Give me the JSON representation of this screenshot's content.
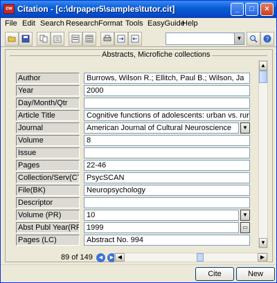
{
  "window": {
    "title": "Citation - [c:\\drpaper5\\samples\\tutor.cit]",
    "app_icon_text": "cw",
    "buttons": {
      "minimize": "_",
      "maximize": "□",
      "close": "×"
    }
  },
  "menu": [
    "File",
    "Edit",
    "Search",
    "Research",
    "Format",
    "Tools",
    "EasyGuide",
    "Help"
  ],
  "toolbar": {
    "icons": [
      "open-folder-icon",
      "save-disk-icon",
      "copy-icon",
      "paste-icon",
      "list-view-icon",
      "detail-view-icon",
      "print-icon",
      "export-icon",
      "import-icon",
      "search-icon",
      "help-icon"
    ],
    "search_value": ""
  },
  "panel": {
    "caption": "Abstracts, Microfiche collections"
  },
  "fields": [
    {
      "label": "Author",
      "value": "Burrows, Wilson R.; Ellitch, Paul B.; Wilson, Ja",
      "button": "none"
    },
    {
      "label": "Year",
      "value": "2000",
      "button": "none"
    },
    {
      "label": "Day/Month/Qtr",
      "value": "",
      "button": "none"
    },
    {
      "label": "Article Title",
      "value": "Cognitive functions of adolescents: urban vs. rura",
      "button": "none"
    },
    {
      "label": "Journal",
      "value": "American Journal of Cultural Neuroscience",
      "button": "dropdown"
    },
    {
      "label": "Volume",
      "value": "8",
      "button": "none"
    },
    {
      "label": "Issue",
      "value": "",
      "button": "none"
    },
    {
      "label": "Pages",
      "value": "22-46",
      "button": "none"
    },
    {
      "label": "Collection/Serv(CT",
      "value": "PsycSCAN",
      "button": "none"
    },
    {
      "label": "File(BK)",
      "value": "Neuropsychology",
      "button": "none"
    },
    {
      "label": "Descriptor",
      "value": "",
      "button": "none"
    },
    {
      "label": "Volume (PR)",
      "value": "10",
      "button": "dropdown"
    },
    {
      "label": "Abst Publ Year(RF)",
      "value": "1999",
      "button": "folder"
    },
    {
      "label": "Pages  (LC)",
      "value": "Abstract No. 994",
      "button": "none"
    }
  ],
  "navigation": {
    "record_count": "89 of 149"
  },
  "bottom": {
    "cite_label": "Cite",
    "new_record_label": "New Record"
  },
  "colors": {
    "titlebar": "#0a5fd8",
    "window_bg": "#ece9d8",
    "field_border": "#7f9db9"
  }
}
